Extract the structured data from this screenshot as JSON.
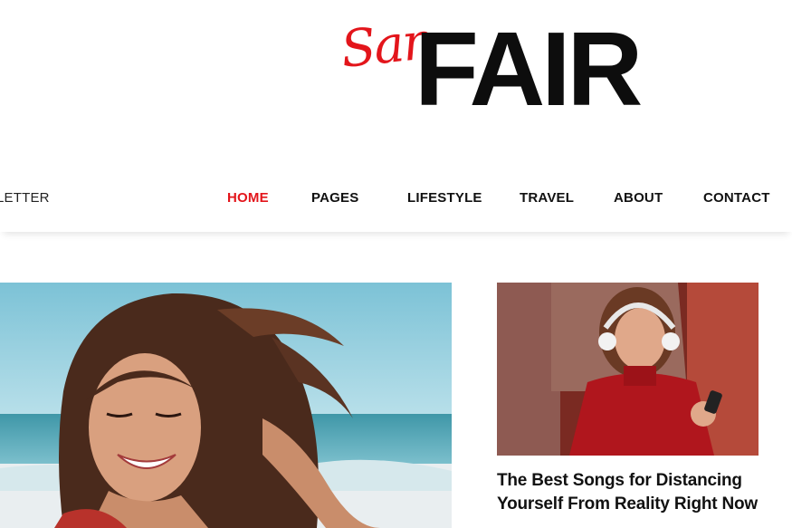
{
  "logo": {
    "script": "San",
    "main": "FAIR"
  },
  "nav": {
    "left_label": "LETTER",
    "items": [
      {
        "label": "HOME",
        "active": true
      },
      {
        "label": "PAGES"
      },
      {
        "label": "LIFESTYLE"
      },
      {
        "label": "TRAVEL"
      },
      {
        "label": "ABOUT"
      },
      {
        "label": "CONTACT"
      }
    ]
  },
  "featured_post": {
    "title": "The Best Songs for Distancing Yourself From Reality Right Now"
  },
  "colors": {
    "accent": "#e3151b",
    "text": "#111111"
  }
}
